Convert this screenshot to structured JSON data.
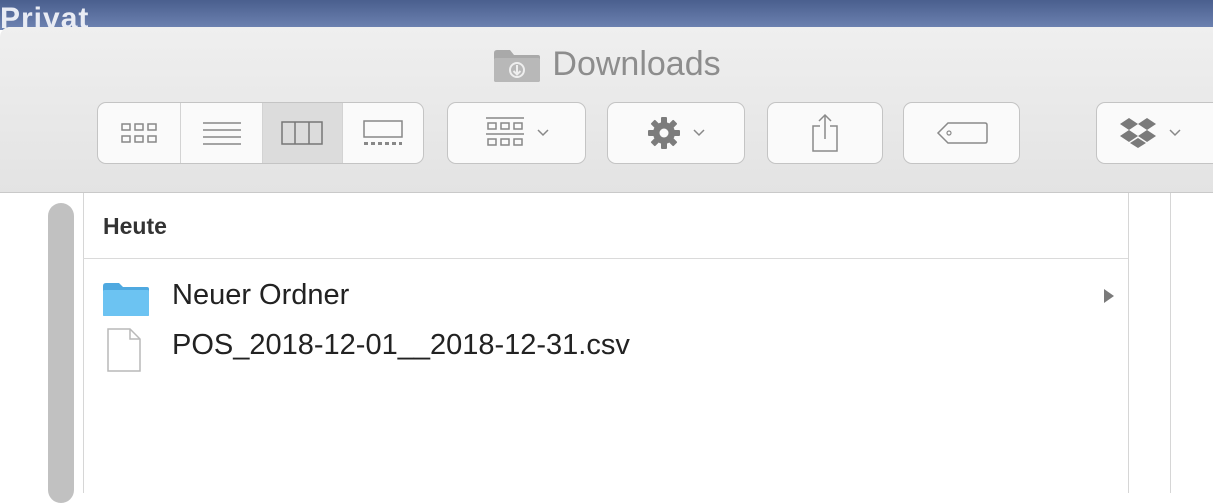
{
  "desktop": {
    "partial_text": "Privat"
  },
  "window": {
    "title": "Downloads",
    "title_icon": "downloads-folder-icon"
  },
  "toolbar": {
    "view_modes": [
      "icon-view",
      "list-view",
      "column-view",
      "gallery-view"
    ],
    "active_view": "column-view",
    "arrange_icon": "grid-arrange-icon",
    "action_icon": "gear-icon",
    "share_icon": "share-icon",
    "tag_icon": "tag-icon",
    "dropbox_icon": "dropbox-icon"
  },
  "section": {
    "title": "Heute"
  },
  "files": [
    {
      "name": "Neuer Ordner",
      "kind": "folder",
      "icon": "folder-icon"
    },
    {
      "name": "POS_2018-12-01__2018-12-31.csv",
      "kind": "file",
      "icon": "document-icon"
    }
  ],
  "colors": {
    "folder_blue": "#5fb8ec",
    "toolbar_bg": "#e9e9e9",
    "title_gray": "#8d8d8d"
  }
}
